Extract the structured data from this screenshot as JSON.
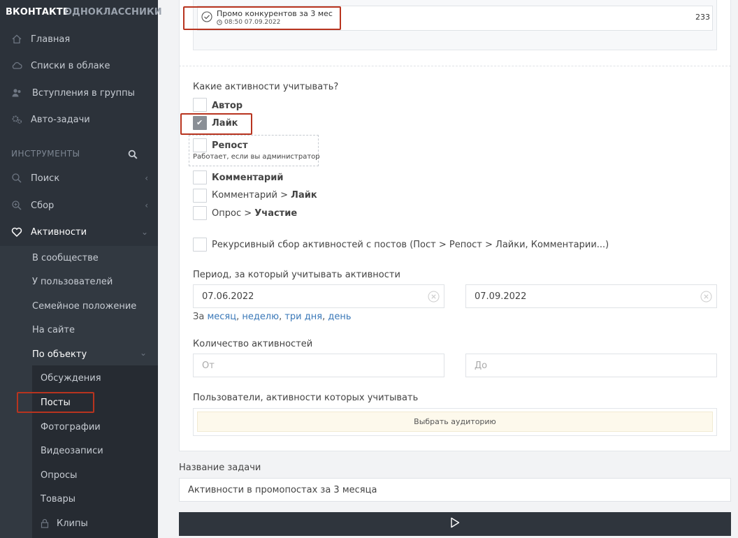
{
  "sidebar": {
    "brand_vk": "ВКОНТАКТЕ",
    "brand_ok": "ОДНОКЛАССНИКИ",
    "nav": [
      {
        "label": "Главная",
        "icon": "home-icon"
      },
      {
        "label": "Списки в облаке",
        "icon": "cloud-icon"
      },
      {
        "label": "Вступления в группы",
        "icon": "users-icon"
      },
      {
        "label": "Авто-задачи",
        "icon": "gears-icon"
      }
    ],
    "tools_title": "ИНСТРУМЕНТЫ",
    "tools": [
      {
        "label": "Поиск",
        "icon": "search-icon"
      },
      {
        "label": "Сбор",
        "icon": "zoom-plus-icon"
      },
      {
        "label": "Активности",
        "icon": "heart-icon"
      }
    ],
    "activity_items": [
      "В сообществе",
      "У пользователей",
      "Семейное положение",
      "На сайте",
      "По объекту"
    ],
    "object_items": [
      "Обсуждения",
      "Посты",
      "Фотографии",
      "Видеозаписи",
      "Опросы",
      "Товары",
      "Клипы"
    ]
  },
  "post": {
    "title": "Промо конкурентов за 3 мес",
    "date": "08:50 07.09.2022",
    "count": "233"
  },
  "activities": {
    "question": "Какие активности учитывать?",
    "author": "Автор",
    "like": "Лайк",
    "repost": "Репост",
    "repost_note": "Работает, если вы администратор",
    "comment": "Комментарий",
    "comment_like_prefix": "Комментарий > ",
    "comment_like_bold": "Лайк",
    "poll_prefix": "Опрос > ",
    "poll_bold": "Участие",
    "recursive": "Рекурсивный сбор активностей с постов (Пост > Репост > Лайки, Комментарии...)"
  },
  "period": {
    "label": "Период, за который учитывать активности",
    "from": "07.06.2022",
    "to": "07.09.2022",
    "prefix": "За ",
    "links": [
      "месяц",
      "неделю",
      "три дня",
      "день"
    ]
  },
  "count": {
    "label": "Количество активностей",
    "from_placeholder": "От",
    "to_placeholder": "До"
  },
  "users": {
    "label": "Пользователи, активности которых учитывать",
    "button": "Выбрать аудиторию"
  },
  "task": {
    "label": "Название задачи",
    "value": "Активности в промопостах за 3 месяца"
  },
  "colors": {
    "sidebar_bg": "#2c323a",
    "highlight_red": "#b8341f",
    "link_blue": "#3a78b8",
    "run_button_bg": "#2f353d"
  }
}
